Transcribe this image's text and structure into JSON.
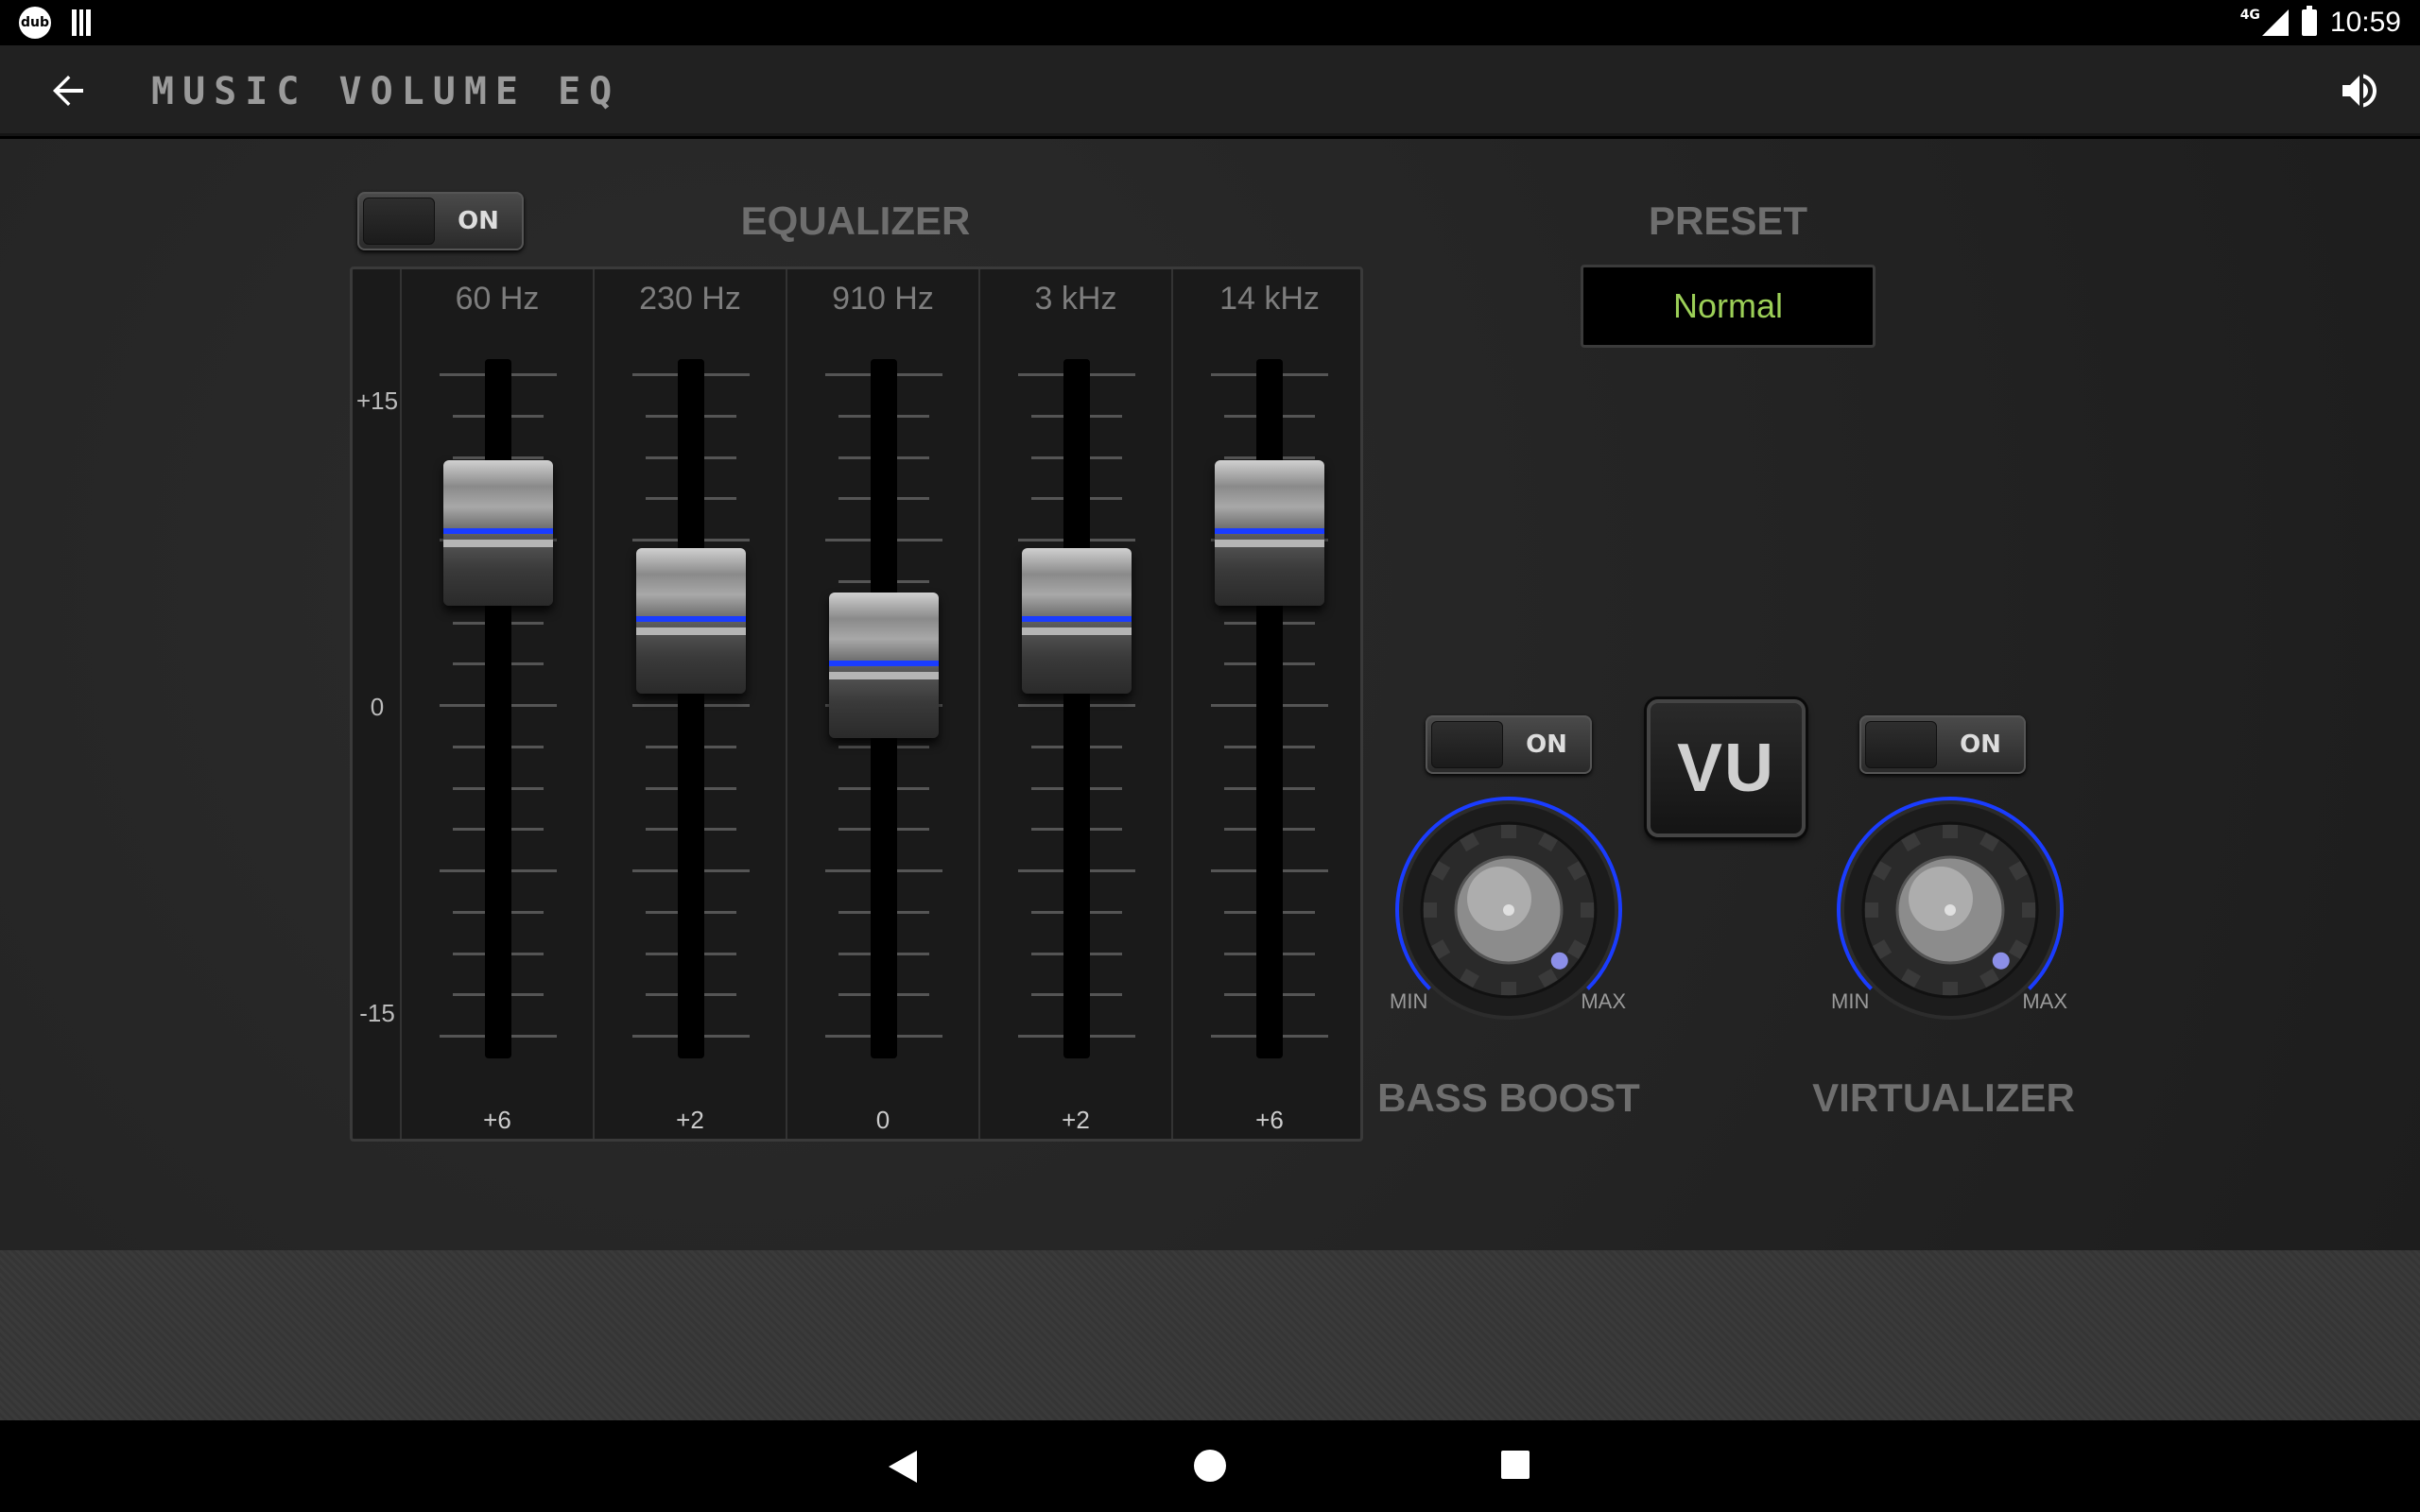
{
  "status_bar": {
    "app_badge": "dub",
    "network": "4G",
    "time": "10:59"
  },
  "app_bar": {
    "title": "Music Volume EQ",
    "back_icon": "arrow-left-icon",
    "volume_icon": "speaker-volume-icon"
  },
  "equalizer": {
    "label": "EQUALIZER",
    "toggle_label": "ON",
    "enabled": true,
    "scale": {
      "max": "+15",
      "mid": "0",
      "min": "-15"
    },
    "bands": [
      {
        "freq": "60 Hz",
        "value": "+6",
        "level": 6
      },
      {
        "freq": "230 Hz",
        "value": "+2",
        "level": 2
      },
      {
        "freq": "910 Hz",
        "value": "0",
        "level": 0
      },
      {
        "freq": "3 kHz",
        "value": "+2",
        "level": 2
      },
      {
        "freq": "14 kHz",
        "value": "+6",
        "level": 6
      }
    ]
  },
  "preset": {
    "label": "PRESET",
    "value": "Normal",
    "value_color": "#9ccf57"
  },
  "vu_button": {
    "label": "VU"
  },
  "bass_boost": {
    "label": "BASS BOOST",
    "toggle_label": "ON",
    "enabled": true,
    "min_label": "MIN",
    "max_label": "MAX",
    "level": 1.0
  },
  "virtualizer": {
    "label": "VIRTUALIZER",
    "toggle_label": "ON",
    "enabled": true,
    "min_label": "MIN",
    "max_label": "MAX",
    "level": 1.0
  },
  "colors": {
    "accent_blue": "#1a3cff",
    "preset_green": "#9ccf57"
  }
}
